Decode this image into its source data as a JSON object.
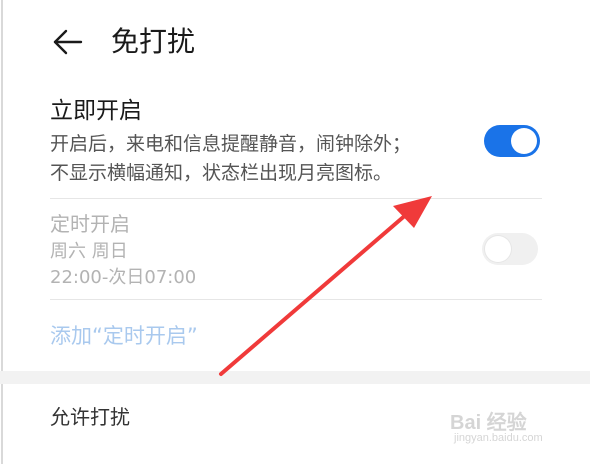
{
  "header": {
    "title": "免打扰"
  },
  "immediate": {
    "title": "立即开启",
    "desc_line1": "开启后，来电和信息提醒静音，闹钟除外；",
    "desc_line2": "不显示横幅通知，状态栏出现月亮图标。",
    "enabled": true
  },
  "scheduled": {
    "title": "定时开启",
    "days": "周六 周日",
    "time_range": "22:00-次日07:00",
    "enabled": false
  },
  "add_schedule": {
    "label": "添加“定时开启”"
  },
  "allow": {
    "label": "允许打扰"
  },
  "watermark": {
    "brand": "Bai 经验",
    "url": "jingyan.baidu.com"
  },
  "colors": {
    "accent": "#1a73e8",
    "annotation_arrow": "#f03a3a",
    "link_disabled": "#a9c9ee"
  },
  "icons": {
    "back": "back-arrow-icon",
    "annotation": "annotation-arrow-icon"
  }
}
